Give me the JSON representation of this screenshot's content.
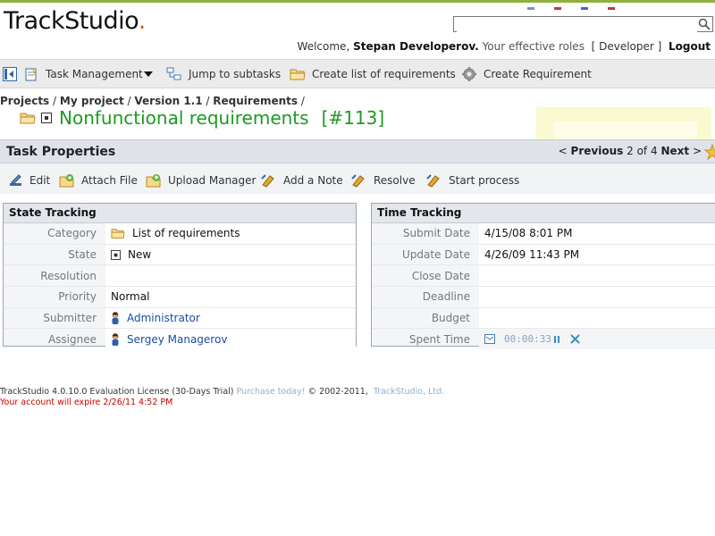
{
  "header": {
    "logo_text": "TrackStudio",
    "logo_dot": ".",
    "search": {
      "value": "",
      "placeholder": ""
    },
    "welcome_prefix": "Welcome,",
    "user_name": "Stepan Developerov.",
    "roles_text": "Your effective roles",
    "role_bracket_open": "[",
    "role": "Developer",
    "role_bracket_close": "]",
    "logout": "Logout"
  },
  "toolbar": {
    "task_management": "Task Management",
    "jump_subtasks": "Jump to subtasks",
    "create_list": "Create list of requirements",
    "create_requirement": "Create Requirement"
  },
  "breadcrumb": {
    "projects": "Projects",
    "my_project": "My project",
    "version": "Version 1.1",
    "requirements": "Requirements",
    "sep": "/"
  },
  "task": {
    "name": "Nonfunctional requirements",
    "number": "[#113]"
  },
  "properties": {
    "title": "Task Properties",
    "pager": {
      "prev_symbol": "<",
      "previous": "Previous",
      "current": "2",
      "of": "of",
      "total": "4",
      "next": "Next",
      "next_symbol": ">"
    }
  },
  "actions": {
    "edit": "Edit",
    "attach_file": "Attach File",
    "upload_manager": "Upload Manager",
    "add_note": "Add a Note",
    "resolve": "Resolve",
    "start_process": "Start process"
  },
  "state_tracking": {
    "title": "State Tracking",
    "rows": [
      {
        "label": "Category",
        "value": "List of requirements"
      },
      {
        "label": "State",
        "value": "New"
      },
      {
        "label": "Resolution",
        "value": ""
      },
      {
        "label": "Priority",
        "value": "Normal"
      },
      {
        "label": "Submitter",
        "value": "Administrator"
      },
      {
        "label": "Assignee",
        "value": "Sergey Managerov"
      }
    ]
  },
  "time_tracking": {
    "title": "Time Tracking",
    "rows": [
      {
        "label": "Submit Date",
        "value": "4/15/08 8:01 PM"
      },
      {
        "label": "Update Date",
        "value": "4/26/09 11:43 PM"
      },
      {
        "label": "Close Date",
        "value": ""
      },
      {
        "label": "Deadline",
        "value": ""
      },
      {
        "label": "Budget",
        "value": ""
      },
      {
        "label": "Spent Time",
        "value": "00:00:33"
      }
    ]
  },
  "footer": {
    "license": "TrackStudio 4.0.10.0 Evaluation License (30-Days Trial)",
    "purchase": "Purchase today!",
    "copyright": "© 2002-2011,",
    "company": "TrackStudio, Ltd.",
    "expire": "Your account will expire 2/26/11 4:52 PM"
  },
  "colors": {
    "title_green": "#1e9a22",
    "link_blue": "#1a4da1",
    "expire_red": "#cc0000",
    "logo_dot_orange": "#e05a00"
  }
}
